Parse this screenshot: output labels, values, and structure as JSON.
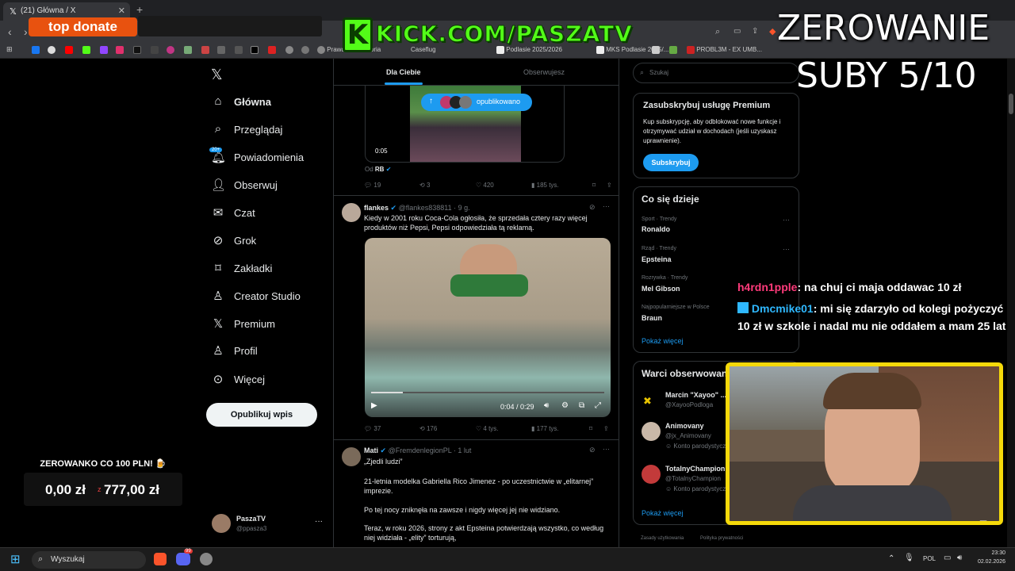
{
  "browser": {
    "tab_title": "(21) Główna / X",
    "new_tab": "+",
    "bookmarks": [
      "Prawdziwa Historia",
      "Caseflug",
      "Podlasie 2025/2026",
      "MKS Podlasie 2025/...",
      "PROBL3M - EX UMB..."
    ]
  },
  "overlay": {
    "donate_label": "top donate",
    "kick_url": "KICK.COM/PASZATV",
    "zerowanie_line1": "ZEROWANIE",
    "zerowanie_line2": "SUBY 5/10",
    "goal_title": "ZEROWANKO CO 100 PLN! 🍺",
    "goal_current": "0,00 zł",
    "goal_sep": "z",
    "goal_target": "777,00 zł"
  },
  "nav": {
    "items": [
      {
        "label": "Główna",
        "icon": "home-icon"
      },
      {
        "label": "Przeglądaj",
        "icon": "search-icon"
      },
      {
        "label": "Powiadomienia",
        "icon": "bell-icon"
      },
      {
        "label": "Obserwuj",
        "icon": "follow-icon"
      },
      {
        "label": "Czat",
        "icon": "mail-icon"
      },
      {
        "label": "Grok",
        "icon": "grok-icon"
      },
      {
        "label": "Zakładki",
        "icon": "bookmark-icon"
      },
      {
        "label": "Creator Studio",
        "icon": "creator-icon"
      },
      {
        "label": "Premium",
        "icon": "x-icon"
      },
      {
        "label": "Profil",
        "icon": "profile-icon"
      },
      {
        "label": "Więcej",
        "icon": "more-icon"
      }
    ],
    "notif_badge": "20+",
    "post_button": "Opublikuj wpis",
    "account_name": "PaszaTV",
    "account_handle": "@ppasza3"
  },
  "feed": {
    "tabs": [
      "Dla Ciebie",
      "Obserwujesz"
    ],
    "published_pill": "opublikowano",
    "tweet0": {
      "video_time": "0:05",
      "from_label": "Od",
      "from_name": "RB",
      "replies": "19",
      "reposts": "3",
      "likes": "420",
      "views": "185 tys."
    },
    "tweet1": {
      "name": "flankes",
      "handle": "@flankes838811 · 9 g.",
      "text": "Kiedy w 2001 roku Coca-Cola ogłosiła, że sprzedała cztery razy więcej produktów niż Pepsi, Pepsi odpowiedziała tą reklamą.",
      "video_time": "0:04 / 0:29",
      "replies": "37",
      "reposts": "176",
      "likes": "4 tys.",
      "views": "177 tys."
    },
    "tweet2": {
      "name": "Mati",
      "handle": "@FremdenlegionPL · 1 lut",
      "line1": "„Zjedli ludzi”",
      "line2": "21-letnia modelka Gabriella Rico Jimenez - po uczestnictwie w „elitarnej” imprezie.",
      "line3": "Po tej nocy zniknęła na zawsze i nigdy więcej jej nie widziano.",
      "line4": "Teraz, w roku 2026, strony z akt Epsteina potwierdzają wszystko, co według niej widziała - „elity” torturują,"
    }
  },
  "sidebar": {
    "search_placeholder": "Szukaj",
    "premium_title": "Zasubskrybuj usługę Premium",
    "premium_text": "Kup subskrypcję, aby odblokować nowe funkcje i otrzymywać udział w dochodach (jeśli uzyskasz uprawnienie).",
    "premium_button": "Subskrybuj",
    "trends_title": "Co się dzieje",
    "trends": [
      {
        "meta": "Sport · Trendy",
        "name": "Ronaldo"
      },
      {
        "meta": "Rząd · Trendy",
        "name": "Epsteina"
      },
      {
        "meta": "Rozrywka · Trendy",
        "name": "Mel Gibson"
      },
      {
        "meta": "Najpopularniejsze w Polsce",
        "name": "Braun"
      }
    ],
    "show_more": "Pokaż więcej",
    "follow_title": "Warci obserwowania",
    "follow": [
      {
        "name": "Marcin \"Xayoo\" ...",
        "handle": "@XayooPodloga",
        "note": ""
      },
      {
        "name": "Animovany",
        "handle": "@jx_Animovany",
        "note": "Konto parodystyczne"
      },
      {
        "name": "TotalnyChampion",
        "handle": "@TotalnyChampion",
        "note": "Konto parodystyczne"
      }
    ],
    "show_more2": "Pokaż więcej",
    "footer1": "Zasady użytkowania",
    "footer2": "Polityka prywatności"
  },
  "chat": [
    {
      "user": "h4rdn1pple",
      "user_color": "#ff3b7b",
      "message": ": na chuj ci maja oddawac 10 zł"
    },
    {
      "user": "Dmcmike01",
      "user_color": "#2fb8ff",
      "message": ": mi się zdarzyło od kolegi pożyczyć 10 zł w szkole i nadal mu nie oddałem a mam 25 lat"
    }
  ],
  "taskbar": {
    "search": "Wyszukaj",
    "lang": "POL",
    "time": "23:30",
    "date": "02.02.2026",
    "discord_badge": "99"
  },
  "colors": {
    "accent": "#1d9bf0",
    "donate": "#e8520f",
    "kick": "#53fc18",
    "cam_border": "#f5d90a"
  }
}
